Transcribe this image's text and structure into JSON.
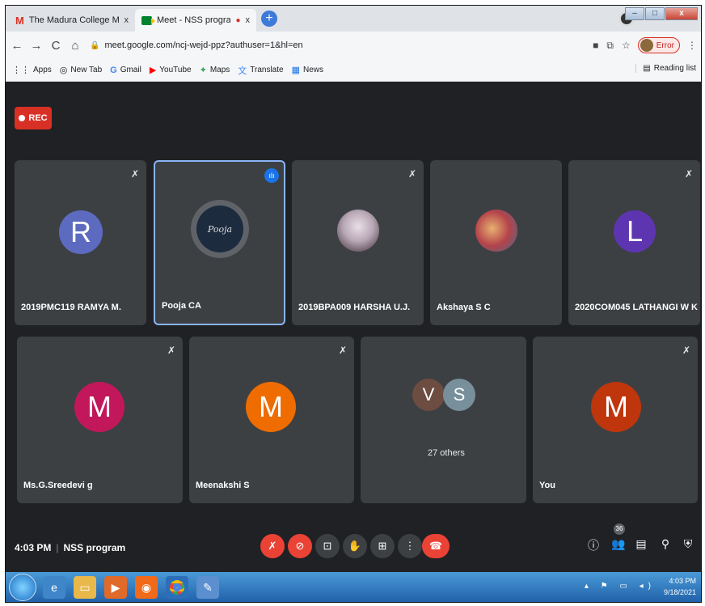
{
  "browser": {
    "tabs": [
      {
        "title": "The Madura College Mail",
        "icon": "gmail-icon"
      },
      {
        "title": "Meet - NSS program",
        "icon": "meet-icon"
      }
    ],
    "tab_close": "x",
    "new_tab": "+",
    "url": "meet.google.com/ncj-wejd-ppz?authuser=1&hl=en",
    "profile_status": "Error",
    "window_buttons": {
      "minimize": "–",
      "maximize": "□",
      "close": "x"
    },
    "nav": {
      "back": "←",
      "forward": "→",
      "reload": "C",
      "home": "⌂"
    }
  },
  "bookmarks": {
    "items": [
      {
        "label": "Apps",
        "icon": "⋮⋮"
      },
      {
        "label": "New Tab",
        "icon": "◎"
      },
      {
        "label": "Gmail",
        "icon": "G"
      },
      {
        "label": "YouTube",
        "icon": "▶"
      },
      {
        "label": "Maps",
        "icon": "✦"
      },
      {
        "label": "Translate",
        "icon": "文"
      },
      {
        "label": "News",
        "icon": "▦"
      }
    ],
    "reading_list": "Reading list"
  },
  "meet": {
    "rec_label": "REC",
    "participants": [
      {
        "name": "2019PMC119 RAMYA M.",
        "initial": "R",
        "color": "#5c6bc0"
      },
      {
        "name": "Pooja CA",
        "initial": "",
        "color": "#1d2b3f",
        "photo_text": "Pooja"
      },
      {
        "name": "2019BPA009 HARSHA U.J.",
        "initial": "",
        "color": "#c9b8c4"
      },
      {
        "name": "Akshaya S C",
        "initial": "",
        "color": "#b4434a"
      },
      {
        "name": "2020COM045 LATHANGI W K",
        "initial": "L",
        "color": "#5e35b1"
      },
      {
        "name": "Ms.G.Sreedevi g",
        "initial": "M",
        "color": "#c2185b"
      },
      {
        "name": "Meenakshi S",
        "initial": "M",
        "color": "#ef6c00"
      },
      {
        "name": "You",
        "initial": "M",
        "color": "#bf360c"
      }
    ],
    "others_tile": {
      "initials": [
        "V",
        "S"
      ],
      "colors": [
        "#6d4c41",
        "#78909c"
      ],
      "label": "27 others"
    },
    "time": "4:03 PM",
    "meeting_name": "NSS program",
    "participant_count": "36",
    "mute_icon": "🎙̸"
  },
  "taskbar": {
    "time": "4:03 PM",
    "date": "9/18/2021"
  }
}
